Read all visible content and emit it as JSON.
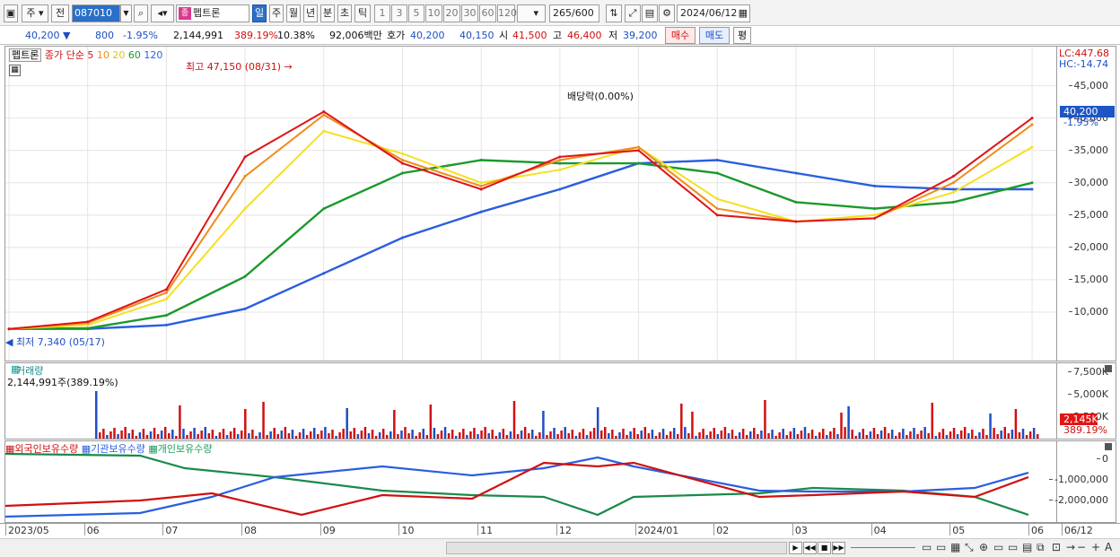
{
  "toolbar": {
    "period_main": "주",
    "period_prev": "전",
    "code": "087010",
    "name_mark": "종",
    "name": "펩트론",
    "periods": [
      "일",
      "주",
      "월",
      "년",
      "분",
      "초",
      "틱"
    ],
    "selected_period": "일",
    "intervals": [
      "1",
      "3",
      "5",
      "10",
      "20",
      "30",
      "60",
      "120"
    ],
    "count": "265",
    "count_total": "/600",
    "date": "2024/06/12"
  },
  "quote": {
    "price": "40,200",
    "change": "800",
    "change_pct": "-1.95%",
    "volume": "2,144,991",
    "volume_ratio": "389.19%",
    "turnover": "10.38%",
    "amount": "92,006백만",
    "bid_label": "호가",
    "ask": "40,200",
    "bid": "40,150",
    "open_label": "시",
    "open": "41,500",
    "high_label": "고",
    "high": "46,400",
    "low_label": "저",
    "low": "39,200",
    "buy": "매수",
    "sell": "매도",
    "eval": "평"
  },
  "price_panel": {
    "legend_name": "펩트론",
    "legend_ma_label": "종가 단순",
    "legend_ma": [
      "5",
      "10",
      "20",
      "60",
      "120"
    ],
    "high_annot": "최고 47,150 (08/31)",
    "low_annot": "최저 7,340 (05/17)",
    "dividend_annot": "배당락(0.00%)",
    "lc": "LC:447.68",
    "hc": "HC:-14.74",
    "y_ticks": [
      "45,000",
      "40,000",
      "35,000",
      "30,000",
      "25,000",
      "20,000",
      "15,000",
      "10,000"
    ],
    "last_price": "40,200",
    "last_pct": "-1.95%"
  },
  "volume_panel": {
    "title": "거래량",
    "value": "2,144,991주(389.19%)",
    "y_ticks": [
      "7,500K",
      "5,000K",
      "2,500K"
    ],
    "last": "2,145K",
    "last_pct": "389.19%"
  },
  "holding_panel": {
    "legend": [
      "외국인보유수량",
      "기관보유수량",
      "개인보유수량"
    ],
    "y_ticks": [
      "0",
      "-1,000,000",
      "-2,000,000"
    ]
  },
  "x_labels": [
    "2023/05",
    "06",
    "07",
    "08",
    "09",
    "10",
    "11",
    "12",
    "2024/01",
    "02",
    "03",
    "04",
    "05",
    "06"
  ],
  "x_end": "06/12",
  "colors": {
    "ma5": "#e01515",
    "ma10": "#f08c1a",
    "ma20": "#f5e020",
    "ma60": "#1a9a2c",
    "ma120": "#2a5ee0",
    "up": "#d01010",
    "down": "#1d4fc4"
  },
  "chart_data": {
    "type": "line",
    "x": [
      "2023/05",
      "06",
      "07",
      "08",
      "09",
      "10",
      "11",
      "12",
      "2024/01",
      "02",
      "03",
      "04",
      "05",
      "06"
    ],
    "series": [
      {
        "name": "5",
        "values": [
          7400,
          8500,
          13500,
          34000,
          41000,
          33000,
          29000,
          34000,
          35000,
          25000,
          24000,
          24500,
          31000,
          40000
        ]
      },
      {
        "name": "10",
        "values": [
          7400,
          8300,
          13000,
          31000,
          40500,
          33500,
          29500,
          33500,
          35500,
          26000,
          24000,
          24500,
          30000,
          39000
        ]
      },
      {
        "name": "20",
        "values": [
          7400,
          8000,
          12000,
          26000,
          38000,
          34500,
          30000,
          32000,
          35500,
          27500,
          24000,
          25000,
          28500,
          35500
        ]
      },
      {
        "name": "60",
        "values": [
          7400,
          7500,
          9500,
          15500,
          26000,
          31500,
          33500,
          33000,
          33000,
          31500,
          27000,
          26000,
          27000,
          30000
        ]
      },
      {
        "name": "120",
        "values": [
          7400,
          7400,
          8000,
          10500,
          16000,
          21500,
          25500,
          29000,
          33000,
          33500,
          31500,
          29500,
          29000,
          29000
        ]
      }
    ],
    "ylim": [
      5000,
      48000
    ]
  }
}
